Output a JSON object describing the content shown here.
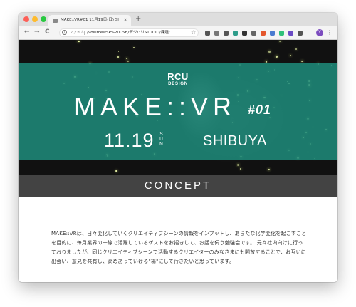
{
  "browser": {
    "tab_title": "MAKE::VR#01 11月19日(日) SHIBUYA",
    "tab_close": "×",
    "new_tab": "+",
    "back": "←",
    "forward": "→",
    "reload": "C",
    "address_scheme": "ファイル",
    "address_url": "/Volumes/SP%20USB/デジハリSTUDIO/課題/...",
    "star": "☆",
    "profile_initial": "Y",
    "menu": "⋮",
    "extensions": [
      "#555555",
      "#777777",
      "#555555",
      "#2e9c8a",
      "#333333",
      "#666666",
      "#e4572e",
      "#4a7bd0",
      "#30c07a",
      "#6a4bc4",
      "#555555"
    ]
  },
  "hero": {
    "logo_main": "RCU",
    "logo_sub": "DESIGN",
    "event_title": "MAKE::VR",
    "event_issue": "#01",
    "date": "11.19",
    "weekday": "SUN",
    "location": "SHIBUYA",
    "band_color": "#1e8c7c"
  },
  "section": {
    "heading": "CONCEPT"
  },
  "concept_text": "MAKE::VRは、日々変化していくクリエイティブシーンの情報をインプットし、あらたな化学変化を起こすことを目的に、毎月業界の一線で活躍しているゲストをお招きして、お話を伺う勉強会です。 元々社内向けに行っておりましたが、同じクリエイティブシーンで活動するクリエイターのみなさまにも開放することで、お互いに出会い、意見を共有し、高めあっていける\"場\"にして行きたいと思っています。"
}
